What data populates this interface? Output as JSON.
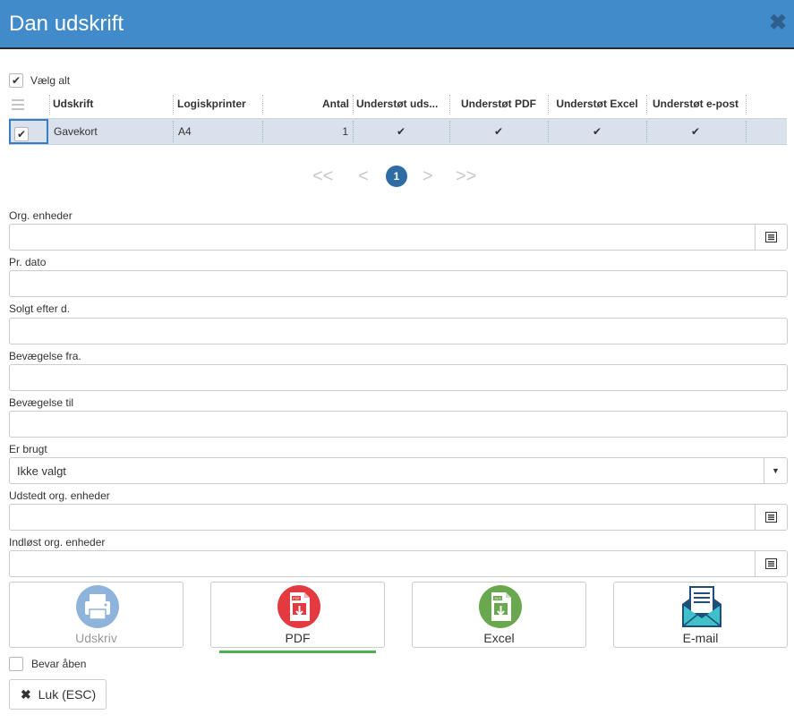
{
  "dialog": {
    "title": "Dan udskrift",
    "close_icon": "close-icon"
  },
  "select_all": {
    "label": "Vælg alt",
    "checked": true
  },
  "table": {
    "columns": [
      "Udskrift",
      "Logiskprinter",
      "Antal",
      "Understøt uds...",
      "Understøt PDF",
      "Understøt Excel",
      "Understøt e-post"
    ],
    "rows": [
      {
        "checked": true,
        "udskrift": "Gavekort",
        "logiskprinter": "A4",
        "antal": "1",
        "uds": "✔",
        "pdf": "✔",
        "excel": "✔",
        "epost": "✔"
      }
    ]
  },
  "pager": {
    "first": "<<",
    "prev": "<",
    "current": "1",
    "next": ">",
    "last": ">>"
  },
  "fields": {
    "org_enheder": {
      "label": "Org. enheder",
      "value": ""
    },
    "pr_dato": {
      "label": "Pr. dato",
      "value": ""
    },
    "solgt_efter": {
      "label": "Solgt efter d.",
      "value": ""
    },
    "bevaegelse_fra": {
      "label": "Bevægelse fra.",
      "value": ""
    },
    "bevaegelse_til": {
      "label": "Bevægelse til",
      "value": ""
    },
    "er_brugt": {
      "label": "Er brugt",
      "value": "Ikke valgt"
    },
    "udstedt_org": {
      "label": "Udstedt org. enheder",
      "value": ""
    },
    "indlost_org": {
      "label": "Indløst org. enheder",
      "value": ""
    }
  },
  "outputs": {
    "udskriv": {
      "label": "Udskriv",
      "enabled": false
    },
    "pdf": {
      "label": "PDF",
      "selected": true
    },
    "excel": {
      "label": "Excel"
    },
    "email": {
      "label": "E-mail"
    }
  },
  "keep_open": {
    "label": "Bevar åben",
    "checked": false
  },
  "close_button": {
    "label": "Luk (ESC)"
  },
  "colors": {
    "title_bar": "#428bca",
    "row_selected": "#d8e1ec",
    "pager_active": "#2e6ca4",
    "active_underline": "#4caf50",
    "pdf_red": "#e23a3f",
    "excel_green": "#6aa84f",
    "print_blue": "#8fb4dc",
    "email_teal": "#3ec1c9"
  }
}
